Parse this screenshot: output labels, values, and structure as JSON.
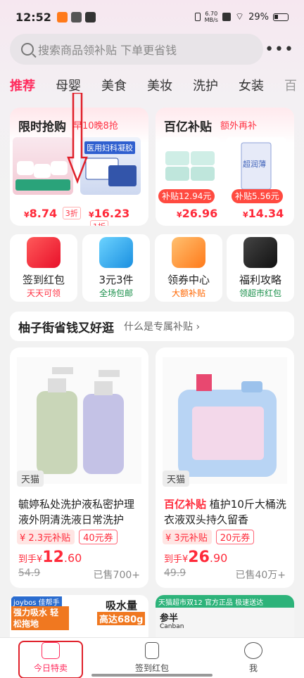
{
  "status": {
    "time": "12:52",
    "netspeed_value": "6.70",
    "netspeed_unit": "MB/s",
    "battery": "29%"
  },
  "search": {
    "placeholder": "搜索商品领补贴 下单更省钱"
  },
  "tabs": [
    {
      "label": "推荐"
    },
    {
      "label": "母婴"
    },
    {
      "label": "美食"
    },
    {
      "label": "美妆"
    },
    {
      "label": "洗护"
    },
    {
      "label": "女装"
    },
    {
      "label": "百"
    }
  ],
  "flash": {
    "title": "限时抢购",
    "subtitle": "早10晚8抢",
    "item1": {
      "price_symbol": "¥",
      "price": "8.74",
      "badge": "3折"
    },
    "item2": {
      "price_symbol": "¥",
      "price": "16.23",
      "badge": "1折"
    },
    "product_text": "医用妇科凝胶"
  },
  "billion": {
    "title": "百亿补贴",
    "subtitle": "额外再补",
    "item1": {
      "tag": "补贴12.94元",
      "price_symbol": "¥",
      "price": "26.96"
    },
    "item2": {
      "tag": "补贴5.56元",
      "price_symbol": "¥",
      "price": "14.34"
    },
    "product_text": "超润薄"
  },
  "quick": [
    {
      "label": "签到红包",
      "sub": "天天可领",
      "color": "#ff3344"
    },
    {
      "label": "3元3件",
      "sub": "全场包邮",
      "color": "#1a8f4a"
    },
    {
      "label": "领券中心",
      "sub": "大额补贴",
      "color": "#ff6600"
    },
    {
      "label": "福利攻略",
      "sub": "领超市红包",
      "color": "#1a8f4a"
    }
  ],
  "section": {
    "title": "柚子街省钱又好逛",
    "link": "什么是专属补贴"
  },
  "products": [
    {
      "platform": "天猫",
      "name": "毓婷私处洗护液私密护理液外阴清洗液日常洗护",
      "subsidy": "2.3元补贴",
      "coupon": "40元券",
      "final_prefix": "到手¥",
      "final_int": "12",
      "final_dec": ".60",
      "original": "54.9",
      "sold": "已售700+"
    },
    {
      "platform": "天猫",
      "highlight": "百亿补贴",
      "name": " 植护10斤大桶洗衣液双头持久留香",
      "subsidy": "3元补贴",
      "coupon": "20元券",
      "final_prefix": "到手¥",
      "final_int": "26",
      "final_dec": ".90",
      "original": "49.9",
      "sold": "已售40万+"
    }
  ],
  "teasers": {
    "left_brand": "joybos 佳帮手",
    "left_title": "吸水量",
    "left_sub": "高达680g",
    "left_promo": "强力吸水 轻松拖地",
    "right_banner": "天猫超市双12 官方正品 极速送达",
    "right_brand": "参半",
    "right_brand_en": "Canban"
  },
  "nav": [
    {
      "label": "今日特卖"
    },
    {
      "label": "签到红包"
    },
    {
      "label": "我"
    }
  ]
}
